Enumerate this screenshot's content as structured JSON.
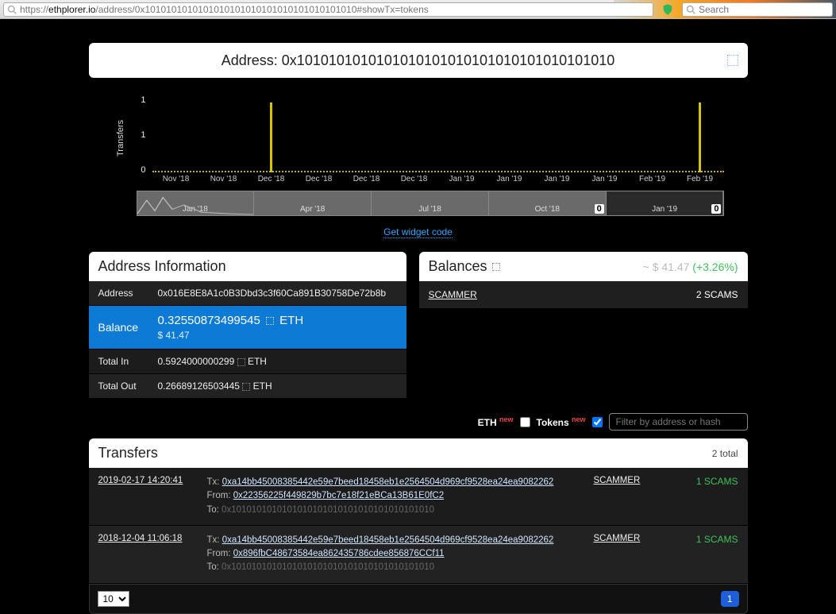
{
  "browser": {
    "url_prefix": "https://",
    "url_domain": "ethplorer.io",
    "url_path": "/address/0x1010101010101010101010101010101010101010#showTx=tokens",
    "search_placeholder": "Search"
  },
  "header": {
    "label": "Address:",
    "address": "0x1010101010101010101010101010101010101010"
  },
  "chart_data": {
    "type": "bar",
    "ylabel": "Transfers",
    "yticks": [
      0,
      1,
      1
    ],
    "categories": [
      "Nov '18",
      "Nov '18",
      "Dec '18",
      "Dec '18",
      "Dec '18",
      "Dec '18",
      "Jan '19",
      "Jan '19",
      "Jan '19",
      "Jan '19",
      "Feb '19",
      "Feb '19"
    ],
    "values": [
      0,
      0,
      1,
      0,
      0,
      0,
      0,
      0,
      0,
      0,
      0,
      1
    ],
    "ylim": [
      0,
      1
    ],
    "mini_axis": [
      "Jan '18",
      "Apr '18",
      "Jul '18",
      "Oct '18",
      "Jan '19"
    ],
    "mini_end_values": [
      "0",
      "0"
    ]
  },
  "widget_link": "Get widget code",
  "addr_info": {
    "title": "Address Information",
    "rows": {
      "address_k": "Address",
      "address_v": "0x016E8E8A1c0B3Dbd3c3f60Ca891B30758De72b8b",
      "balance_k": "Balance",
      "balance_v": "0.32550873499545",
      "balance_unit": "ETH",
      "balance_usd": "$ 41.47",
      "totalin_k": "Total In",
      "totalin_v": "0.5924000000299",
      "totalin_unit": "ETH",
      "totalout_k": "Total Out",
      "totalout_v": "0.26689126503445",
      "totalout_unit": "ETH"
    }
  },
  "balances": {
    "title": "Balances",
    "approx": "~ $ 41.47",
    "pct": "(+3.26%)",
    "row_name": "SCAMMER",
    "row_amt": "2 SCAMS"
  },
  "filter": {
    "eth_label": "ETH",
    "tokens_label": "Tokens",
    "new": "new",
    "placeholder": "Filter by address or hash"
  },
  "transfers": {
    "title": "Transfers",
    "total": "2 total",
    "rows": [
      {
        "date": "2019-02-17 14:20:41",
        "tx_lbl": "Tx:",
        "tx": "0xa14bb45008385442e59e7beed18458eb1e2564504d969cf9528ea24ea9082262",
        "from_lbl": "From:",
        "from": "0x22356225f449829b7bc7e18f21eBCa13B61E0fC2",
        "to_lbl": "To:",
        "to": "0x1010101010101010101010101010101010101010",
        "token": "SCAMMER",
        "amount": "1 SCAMS"
      },
      {
        "date": "2018-12-04 11:06:18",
        "tx_lbl": "Tx:",
        "tx": "0xa14bb45008385442e59e7beed18458eb1e2564504d969cf9528ea24ea9082262",
        "from_lbl": "From:",
        "from": "0x896fbC48673584ea862435786cdee856876CCf11",
        "to_lbl": "To:",
        "to": "0x1010101010101010101010101010101010101010",
        "token": "SCAMMER",
        "amount": "1 SCAMS"
      }
    ]
  },
  "pager": {
    "page_size": "10",
    "current": "1"
  }
}
